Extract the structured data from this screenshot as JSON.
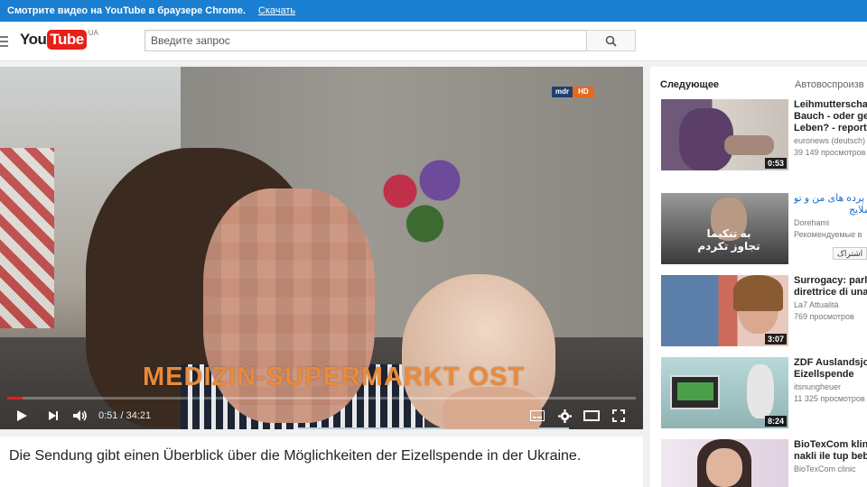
{
  "promo": {
    "text": "Смотрите видео на YouTube в браузере Chrome.",
    "link": "Скачать"
  },
  "masthead": {
    "logo_you": "You",
    "logo_tube": "Tube",
    "country": "UA",
    "search_placeholder": "Введите запрос"
  },
  "player": {
    "channel_badge_left": "mdr",
    "channel_badge_right": "HD",
    "caption": "MEDIZIN-SUPERMARKT OST",
    "time": "0:51 / 34:21",
    "progress": 0.025
  },
  "description": {
    "text": "Die Sendung gibt einen Überblick über die Möglichkeiten der Eizellspende in der Ukraine."
  },
  "sidebar": {
    "heading": "Следующее",
    "autoplay": "Автовоспроизв",
    "items": [
      {
        "title1": "Leihmutterscha",
        "title2": "Bauch - oder ge",
        "title3": "Leben? - report",
        "channel": "euronews (deutsch)",
        "views": "39 149 просмотров",
        "duration": "0:53"
      },
      {
        "title1": "آموزش پرده های من و تو",
        "title2": "اسلایج",
        "channel": "Dorehami",
        "views": "Рекомендуемые в",
        "duration": "",
        "overlay1": "به تنکیما",
        "overlay2": "تجاوز تکردم"
      },
      {
        "title1": "Surrogacy: parl",
        "title2": "direttrice di una",
        "channel": "La7 Attualità",
        "views": "769 просмотров",
        "duration": "3:07"
      },
      {
        "title1": "ZDF Auslandsjo",
        "title2": "Eizellspende",
        "channel": "itsnungheuer",
        "views": "11 325 просмотров",
        "duration": "8:24"
      },
      {
        "title1": "BioTexCom klin",
        "title2": "nakli ile tup beb",
        "channel": "BioTexCom clinic",
        "views": "",
        "duration": ""
      }
    ],
    "subscribe_label": "اشتراک"
  }
}
